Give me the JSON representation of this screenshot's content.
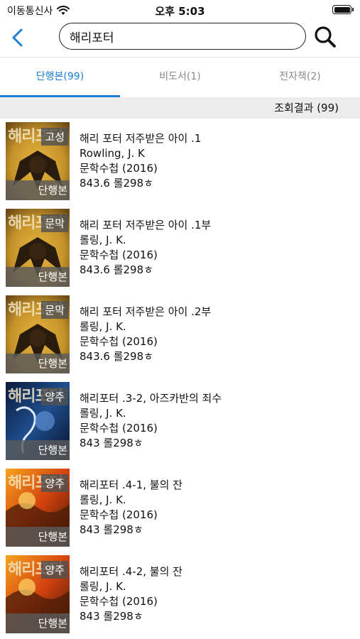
{
  "status": {
    "carrier": "이동통신사",
    "time": "오후 5:03"
  },
  "search": {
    "query": "해리포터"
  },
  "tabs": [
    {
      "label": "단행본(99)",
      "active": true
    },
    {
      "label": "비도서(1)",
      "active": false
    },
    {
      "label": "전자책(2)",
      "active": false
    }
  ],
  "result_count": "조회결과 (99)",
  "books": [
    {
      "cover_text": "해리포터",
      "location": "고성",
      "type": "단행본",
      "title": "해리 포터 저주받은 아이 .1",
      "author": "Rowling, J. K",
      "publisher": "문학수첩 (2016)",
      "call_number": "843.6 롤298ㅎ",
      "cover_style": "yellow"
    },
    {
      "cover_text": "해리포터",
      "location": "문막",
      "type": "단행본",
      "title": "해리 포터 저주받은 아이 .1부",
      "author": "롤링, J. K.",
      "publisher": "문학수첩 (2016)",
      "call_number": "843.6 롤298ㅎ",
      "cover_style": "yellow"
    },
    {
      "cover_text": "해리포터",
      "location": "문막",
      "type": "단행본",
      "title": "해리 포터 저주받은 아이 .2부",
      "author": "롤링, J. K.",
      "publisher": "문학수첩 (2016)",
      "call_number": "843.6 롤298ㅎ",
      "cover_style": "yellow"
    },
    {
      "cover_text": "해리포터",
      "location": "양주",
      "type": "단행본",
      "title": "해리포터 .3-2, 아즈카반의 죄수",
      "author": "롤링, J. K.",
      "publisher": "문학수첩 (2016)",
      "call_number": "843 롤298ㅎ",
      "cover_style": "blue"
    },
    {
      "cover_text": "해리포터",
      "location": "양주",
      "type": "단행본",
      "title": "해리포터 .4-1, 불의 잔",
      "author": "롤링, J. K.",
      "publisher": "문학수첩 (2016)",
      "call_number": "843 롤298ㅎ",
      "cover_style": "fire"
    },
    {
      "cover_text": "해리포터",
      "location": "양주",
      "type": "단행본",
      "title": "해리포터 .4-2, 불의 잔",
      "author": "롤링, J. K.",
      "publisher": "문학수첩 (2016)",
      "call_number": "843 롤298ㅎ",
      "cover_style": "fire"
    }
  ],
  "colors": {
    "accent": "#1a7fd4",
    "result_bar": "#ececec"
  }
}
